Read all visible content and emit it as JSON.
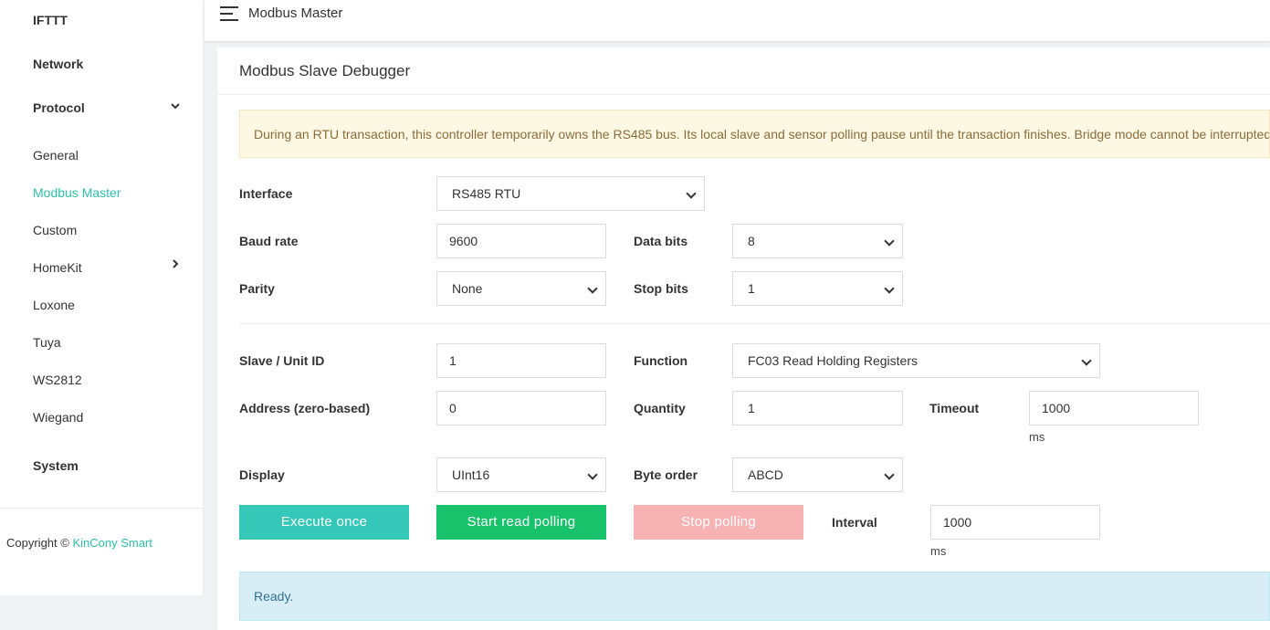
{
  "sidebar": {
    "items": [
      {
        "label": "IFTTT"
      },
      {
        "label": "Network"
      },
      {
        "label": "Protocol"
      },
      {
        "label": "System"
      }
    ],
    "protocol_sub": [
      {
        "label": "General"
      },
      {
        "label": "Modbus Master"
      },
      {
        "label": "Custom"
      },
      {
        "label": "HomeKit"
      },
      {
        "label": "Loxone"
      },
      {
        "label": "Tuya"
      },
      {
        "label": "WS2812"
      },
      {
        "label": "Wiegand"
      }
    ],
    "active_item": "Modbus Master",
    "copyright_prefix": "Copyright ©",
    "copyright_brand": "KinCony Smart"
  },
  "topbar": {
    "title": "Modbus Master"
  },
  "card": {
    "title": "Modbus Slave Debugger",
    "warning": "During an RTU transaction, this controller temporarily owns the RS485 bus. Its local slave and sensor polling pause until the transaction finishes. Bridge mode cannot be interrupted."
  },
  "form": {
    "interface": {
      "label": "Interface",
      "value": "RS485 RTU"
    },
    "baud_rate": {
      "label": "Baud rate",
      "value": "9600"
    },
    "data_bits": {
      "label": "Data bits",
      "value": "8"
    },
    "parity": {
      "label": "Parity",
      "value": "None"
    },
    "stop_bits": {
      "label": "Stop bits",
      "value": "1"
    },
    "slave_id": {
      "label": "Slave / Unit ID",
      "value": "1"
    },
    "function": {
      "label": "Function",
      "value": "FC03 Read Holding Registers"
    },
    "address": {
      "label": "Address (zero-based)",
      "value": "0"
    },
    "quantity": {
      "label": "Quantity",
      "value": "1"
    },
    "timeout": {
      "label": "Timeout",
      "value": "1000",
      "unit": "ms"
    },
    "display": {
      "label": "Display",
      "value": "UInt16"
    },
    "byte_order": {
      "label": "Byte order",
      "value": "ABCD"
    },
    "interval": {
      "label": "Interval",
      "value": "1000",
      "unit": "ms"
    }
  },
  "buttons": {
    "execute": "Execute once",
    "start": "Start read polling",
    "stop": "Stop polling"
  },
  "status": "Ready.",
  "colors": {
    "accent": "#2fbfab",
    "execute": "#35c8b8",
    "start": "#18c26b",
    "stop": "#f7b3b3",
    "warning_bg": "#fcf8e3",
    "info_bg": "#d9edf7"
  }
}
